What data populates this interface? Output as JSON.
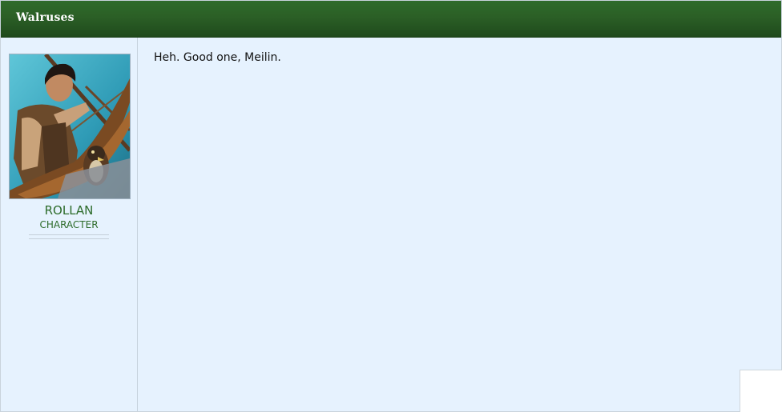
{
  "thread": {
    "title": "Walruses"
  },
  "author": {
    "name": "ROLLAN",
    "rank": "CHARACTER",
    "avatar_icon": "character-portrait-with-falcon"
  },
  "post": {
    "message": "Heh. Good one, Meilin."
  },
  "colors": {
    "header": "#2b5f26",
    "background": "#e6f2fe",
    "author_text": "#2c6b2a"
  }
}
